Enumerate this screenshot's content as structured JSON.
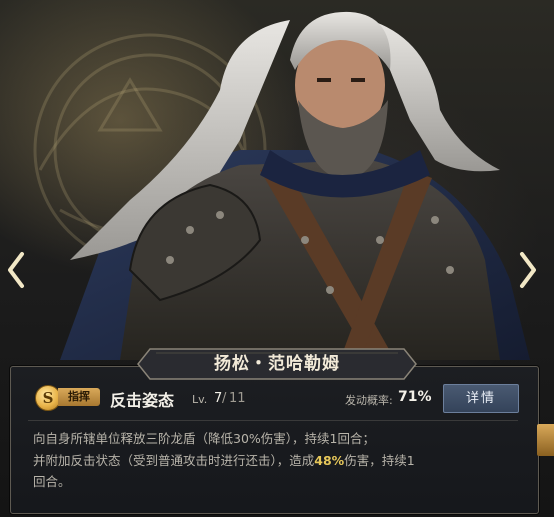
{
  "hero": {
    "name": "扬松・范哈勒姆"
  },
  "skill": {
    "coin_letter": "S",
    "tag": "指挥",
    "name": "反击姿态",
    "level_label": "Lv.",
    "level_current": "7",
    "level_separator": "/",
    "level_max": "11",
    "trigger_label": "发动概率:",
    "trigger_rate": "71%",
    "detail_button": "详情",
    "description": {
      "line1": "向自身所辖单位释放三阶龙盾（降低30%伤害），持续1回合；",
      "line2_a": "并附加反击状态（受到普通攻击时进行还击），造成",
      "line2_highlight": "48%",
      "line2_b": "伤害，持续1",
      "line3": "回合。"
    }
  },
  "colors": {
    "accent_gold": "#e6c75a",
    "button_blue": "#3e4e66",
    "panel_bg": "#1c1e22"
  },
  "icons": {
    "nav_left": "chevron-left-icon",
    "nav_right": "chevron-right-icon",
    "skill_coin": "coin-icon"
  }
}
